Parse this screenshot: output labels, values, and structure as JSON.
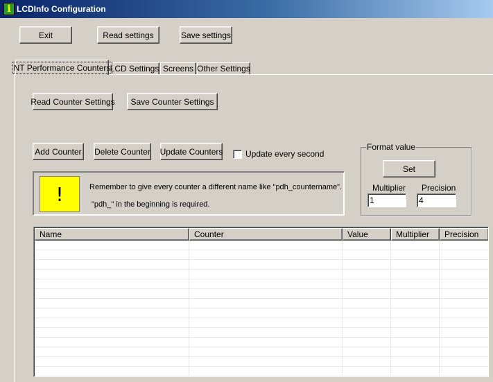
{
  "window": {
    "title": "LCDInfo Configuration",
    "icon": "info-i-icon"
  },
  "toolbar": {
    "exit_label": "Exit",
    "read_settings_label": "Read settings",
    "save_settings_label": "Save settings"
  },
  "tabs": [
    {
      "label": "NT Performance Counters",
      "active": true
    },
    {
      "label": "LCD Settings",
      "active": false
    },
    {
      "label": "Screens",
      "active": false
    },
    {
      "label": "Other Settings",
      "active": false
    }
  ],
  "counters_tab": {
    "read_counter_settings_label": "Read Counter Settings",
    "save_counter_settings_label": "Save Counter Settings",
    "add_counter_label": "Add Counter",
    "delete_counter_label": "Delete Counter",
    "update_counters_label": "Update Counters",
    "update_every_second_label": "Update every second",
    "update_every_second_checked": false,
    "notice": {
      "icon_symbol": "!",
      "line1": "Remember to give every counter a different name like \"pdh_countername\".",
      "line2": "\"pdh_\" in the beginning is required."
    },
    "format_value": {
      "title": "Format value",
      "set_label": "Set",
      "multiplier_label": "Multiplier",
      "multiplier_value": "1",
      "precision_label": "Precision",
      "precision_value": "4"
    },
    "table": {
      "columns": [
        "Name",
        "Counter",
        "Value",
        "Multiplier",
        "Precision"
      ],
      "rows": []
    }
  },
  "colors": {
    "face": "#d4d0c8",
    "titlebar_start": "#0a246a",
    "titlebar_end": "#a6caf0",
    "warning_bg": "#ffff00"
  }
}
